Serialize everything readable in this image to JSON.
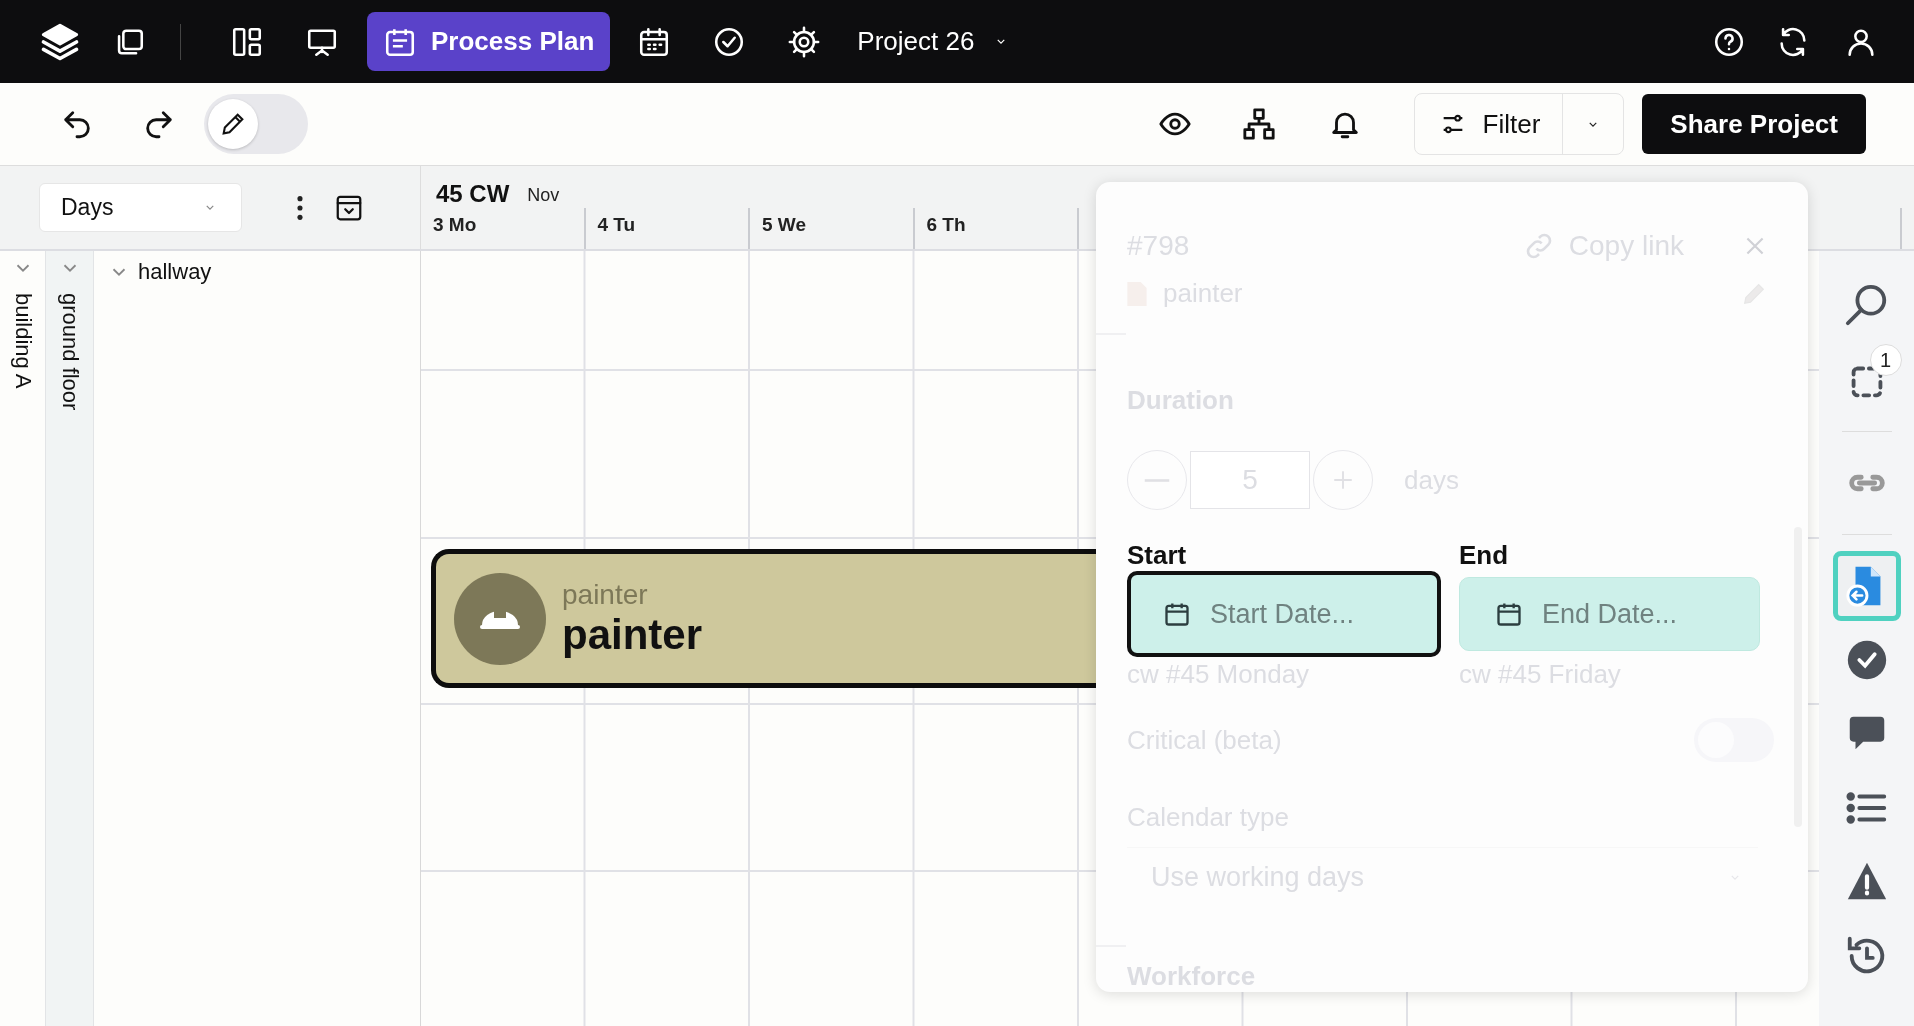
{
  "top_bar": {
    "tabs": [
      {
        "selected": false
      },
      {
        "selected": false
      },
      {
        "label": "Process Plan",
        "selected": true
      },
      {
        "selected": false
      },
      {
        "selected": false
      },
      {
        "selected": false
      }
    ],
    "project": {
      "label": "Project 26"
    }
  },
  "toolbar": {
    "edit_toggle": {
      "on": false
    },
    "filter": {
      "label": "Filter"
    },
    "share_button": "Share Project"
  },
  "view_select": {
    "value": "Days"
  },
  "timeline": {
    "week": "45 CW",
    "month": "Nov",
    "days": [
      "3 Mo",
      "4 Tu",
      "5 We",
      "6 Th"
    ]
  },
  "tree": [
    {
      "label": "building A",
      "expanded": true,
      "children": [
        {
          "label": "ground floor",
          "expanded": true,
          "children": [
            {
              "label": "hallway",
              "expanded": true
            }
          ]
        }
      ]
    }
  ],
  "task_bar": {
    "trade": "painter",
    "title": "painter"
  },
  "task_panel": {
    "id": "#798",
    "copy_link": "Copy link",
    "name": "painter",
    "duration": {
      "label": "Duration",
      "value": "5",
      "unit": "days"
    },
    "dates": [
      {
        "label": "Start",
        "placeholder": "Start Date...",
        "hint": "cw #45 Monday",
        "focused": true
      },
      {
        "label": "End",
        "placeholder": "End Date...",
        "hint": "cw #45 Friday",
        "focused": false
      }
    ],
    "critical": {
      "label": "Critical (beta)",
      "on": false
    },
    "calendar_type": {
      "label": "Calendar type",
      "value": "Use working days"
    },
    "workforce": {
      "label": "Workforce"
    }
  },
  "right_rail": [
    {
      "selected": false
    },
    {
      "selected": false,
      "badge": "1"
    },
    {
      "selected": false
    },
    {
      "selected": true
    },
    {
      "selected": false
    },
    {
      "selected": false
    },
    {
      "selected": false
    },
    {
      "selected": false
    },
    {
      "selected": false
    }
  ]
}
